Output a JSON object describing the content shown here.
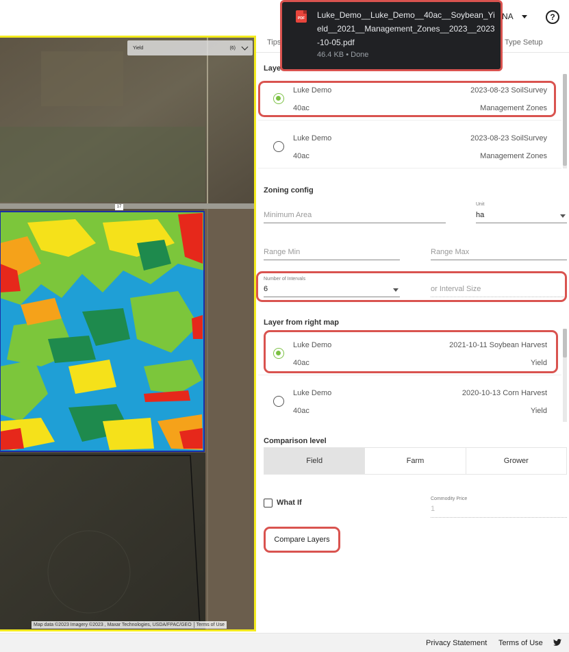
{
  "topbar": {
    "user_label": "NA",
    "help_label": "?"
  },
  "map": {
    "legend_title": "Yield",
    "legend_count": "(6)",
    "road_label": "17",
    "attribution": "Map data ©2023 Imagery ©2023 , Maxar Technologies, USDA/FPAC/GEO",
    "terms": "Terms of Use"
  },
  "panel": {
    "tabs": {
      "tips": "Tips",
      "setup": "g Type Setup"
    },
    "left_layer_heading": "Layer",
    "left_layers": [
      {
        "name": "Luke Demo",
        "acres": "40ac",
        "date": "2023-08-23 SoilSurvey",
        "type": "Management Zones",
        "selected": true
      },
      {
        "name": "Luke Demo",
        "acres": "40ac",
        "date": "2023-08-23 SoilSurvey",
        "type": "Management Zones",
        "selected": false
      }
    ],
    "zoning": {
      "heading": "Zoning config",
      "min_area_placeholder": "Minimum Area",
      "unit_label": "Unit",
      "unit_value": "ha",
      "range_min_placeholder": "Range Min",
      "range_max_placeholder": "Range Max",
      "intervals_label": "Number of Intervals",
      "intervals_value": "6",
      "interval_size_placeholder": "or Interval Size"
    },
    "right_layer_heading": "Layer from right map",
    "right_layers": [
      {
        "name": "Luke Demo",
        "acres": "40ac",
        "date": "2021-10-11 Soybean Harvest",
        "type": "Yield",
        "selected": true
      },
      {
        "name": "Luke Demo",
        "acres": "40ac",
        "date": "2020-10-13 Corn Harvest",
        "type": "Yield",
        "selected": false
      }
    ],
    "comparison": {
      "heading": "Comparison level",
      "options": [
        "Field",
        "Farm",
        "Grower"
      ],
      "active": "Field"
    },
    "what_if": {
      "label": "What If",
      "checked": false,
      "price_label": "Commodity Price",
      "price_value": "1"
    },
    "compare_button": "Compare Layers"
  },
  "footer": {
    "privacy": "Privacy Statement",
    "terms": "Terms of Use",
    "twitter_icon": "twitter-icon"
  },
  "download": {
    "filename": "Luke_Demo__Luke_Demo__40ac__Soybean_Yield__2021__Management_Zones__2023__2023-10-05.pdf",
    "size": "46.4 KB",
    "status": "Done",
    "icon_label": "PDF"
  },
  "colors": {
    "highlight": "#d9534f",
    "map_border": "#f3ea1e",
    "radio_selected": "#7bc043",
    "download_bg": "#202124"
  }
}
